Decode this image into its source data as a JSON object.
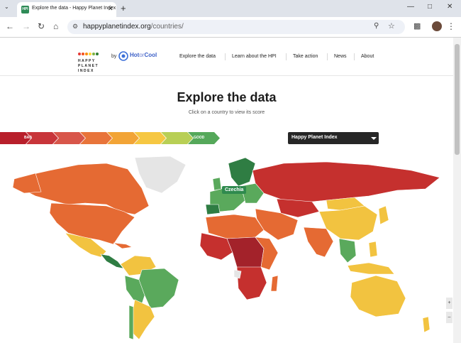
{
  "browser": {
    "tab_title": "Explore the data - Happy Planet Index",
    "tab_favicon_text": "HPI",
    "url_host": "happyplanetindex.org",
    "url_path": "/countries/",
    "icons": [
      "tab-search-icon",
      "close-icon",
      "new-tab-icon",
      "minimize-icon",
      "maximize-icon",
      "window-close-icon",
      "back-icon",
      "forward-icon",
      "reload-icon",
      "home-icon",
      "site-info-icon",
      "zoom-icon",
      "bookmark-star-icon",
      "extensions-icon",
      "avatar"
    ]
  },
  "site": {
    "logo_line1": "HAPPY",
    "logo_line2": "PLANET",
    "logo_line3": "INDEX",
    "by_label": "by",
    "partner_hot": "Hot",
    "partner_or": "or",
    "partner_cool": "Cool",
    "nav": [
      "Explore the data",
      "Learn about the HPI",
      "Take action",
      "News",
      "About"
    ]
  },
  "main": {
    "title": "Explore the data",
    "subtitle": "Click on a country to view its score",
    "legend_bad": "BAD",
    "legend_good": "GOOD",
    "legend_colors": [
      "#b81f2b",
      "#c8353a",
      "#d8564a",
      "#e8743a",
      "#f2a436",
      "#f6c742",
      "#b8cf55",
      "#55a85a"
    ],
    "indicator_select": "Happy Planet Index",
    "hover_country": "Czechia"
  },
  "colors": {
    "red": "#c5302e",
    "dark_red": "#a3222a",
    "orange": "#e56a33",
    "light_orange": "#ef9a3a",
    "yellow": "#f2c340",
    "green": "#5aa95c",
    "dark_green": "#2f7d43",
    "grey": "#e5e5e5"
  }
}
